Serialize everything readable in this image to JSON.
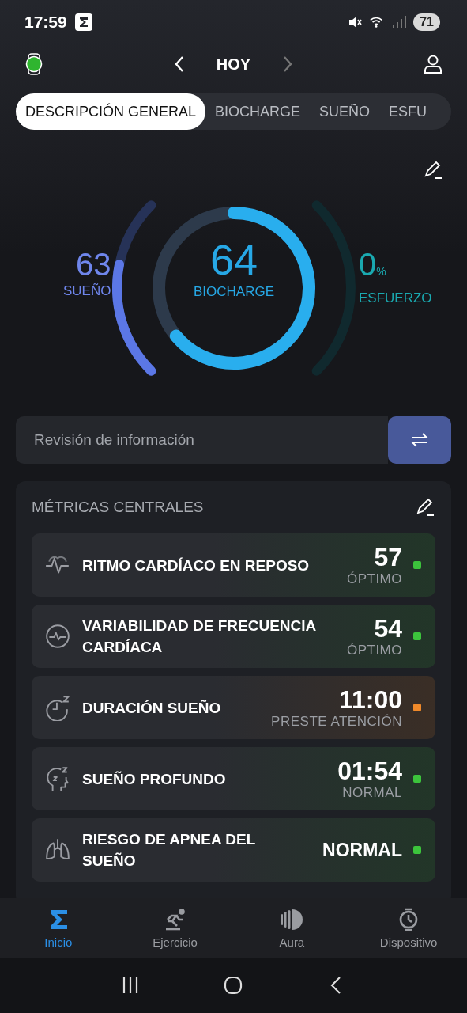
{
  "status_bar": {
    "time": "17:59",
    "battery": "71"
  },
  "header": {
    "title": "HOY"
  },
  "tabs": [
    {
      "label": "DESCRIPCIÓN GENERAL",
      "selected": true
    },
    {
      "label": "BIOCHARGE",
      "selected": false
    },
    {
      "label": "SUEÑO",
      "selected": false
    },
    {
      "label": "ESFU",
      "selected": false
    }
  ],
  "gauges": {
    "sleep": {
      "value": "63",
      "label": "SUEÑO"
    },
    "biocharge": {
      "value": "64",
      "label": "BIOCHARGE"
    },
    "effort": {
      "value": "0",
      "unit": "%",
      "label": "ESFUERZO"
    }
  },
  "info_bar": {
    "placeholder": "Revisión de información"
  },
  "metrics_card": {
    "title": "MÉTRICAS CENTRALES",
    "items": [
      {
        "label": "RITMO CARDÍACO EN REPOSO",
        "value": "57",
        "status": "ÓPTIMO",
        "color": "#3cc43c"
      },
      {
        "label": "VARIABILIDAD DE FRECUENCIA CARDÍACA",
        "value": "54",
        "status": "ÓPTIMO",
        "color": "#3cc43c"
      },
      {
        "label": "DURACIÓN SUEÑO",
        "value": "11:00",
        "status": "PRESTE ATENCIÓN",
        "color": "#f0892a"
      },
      {
        "label": "SUEÑO PROFUNDO",
        "value": "01:54",
        "status": "NORMAL",
        "color": "#3cc43c"
      },
      {
        "label": "RIESGO DE APNEA DEL SUEÑO",
        "value": "NORMAL",
        "color": "#3cc43c"
      }
    ]
  },
  "bottom_nav": [
    {
      "label": "Inicio",
      "selected": true
    },
    {
      "label": "Ejercicio",
      "selected": false
    },
    {
      "label": "Aura",
      "selected": false
    },
    {
      "label": "Dispositivo",
      "selected": false
    }
  ]
}
